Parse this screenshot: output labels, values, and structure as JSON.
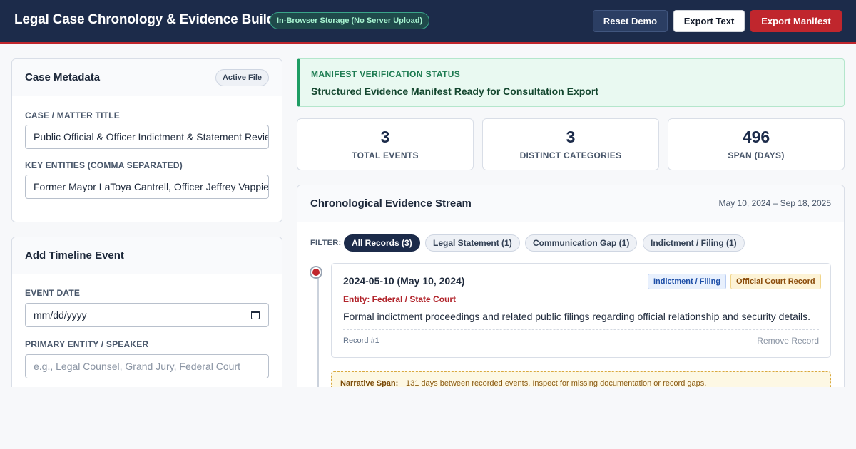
{
  "header": {
    "title": "Legal Case Chronology & Evidence Builder",
    "storage_badge": "In-Browser Storage (No Server Upload)",
    "reset_label": "Reset Demo",
    "export_text_label": "Export Text",
    "export_manifest_label": "Export Manifest"
  },
  "metadata": {
    "title": "Case Metadata",
    "badge": "Active File",
    "case_title_label": "CASE / MATTER TITLE",
    "case_title_value": "Public Official & Officer Indictment & Statement Review",
    "entities_label": "KEY ENTITIES (COMMA SEPARATED)",
    "entities_value": "Former Mayor LaToya Cantrell, Officer Jeffrey Vappie"
  },
  "add_event": {
    "title": "Add Timeline Event",
    "date_label": "EVENT DATE",
    "date_placeholder": "mm/dd/yyyy",
    "entity_label": "PRIMARY ENTITY / SPEAKER",
    "entity_placeholder": "e.g., Legal Counsel, Grand Jury, Federal Court"
  },
  "status": {
    "label": "MANIFEST VERIFICATION STATUS",
    "text": "Structured Evidence Manifest Ready for Consultation Export"
  },
  "stats": [
    {
      "value": "3",
      "label": "TOTAL EVENTS"
    },
    {
      "value": "3",
      "label": "DISTINCT CATEGORIES"
    },
    {
      "value": "496",
      "label": "SPAN (DAYS)"
    }
  ],
  "stream": {
    "title": "Chronological Evidence Stream",
    "range": "May 10, 2024 – Sep 18, 2025",
    "filter_label": "FILTER:",
    "filters": [
      {
        "label": "All Records (3)",
        "active": true
      },
      {
        "label": "Legal Statement (1)",
        "active": false
      },
      {
        "label": "Communication Gap (1)",
        "active": false
      },
      {
        "label": "Indictment / Filing (1)",
        "active": false
      }
    ],
    "event": {
      "date": "2024-05-10 (May 10, 2024)",
      "category_tag": "Indictment / Filing",
      "source_tag": "Official Court Record",
      "entity": "Entity: Federal / State Court",
      "description": "Formal indictment proceedings and related public filings regarding official relationship and security details.",
      "record": "Record #1",
      "remove_label": "Remove Record"
    },
    "narrative": {
      "label": "Narrative Span:",
      "text": "131 days between recorded events. Inspect for missing documentation or record gaps."
    }
  },
  "colors": {
    "header_bg": "#1c2b4a",
    "accent_red": "#c0262d",
    "status_green": "#1f9d64",
    "page_bg": "#f7f8fa"
  }
}
